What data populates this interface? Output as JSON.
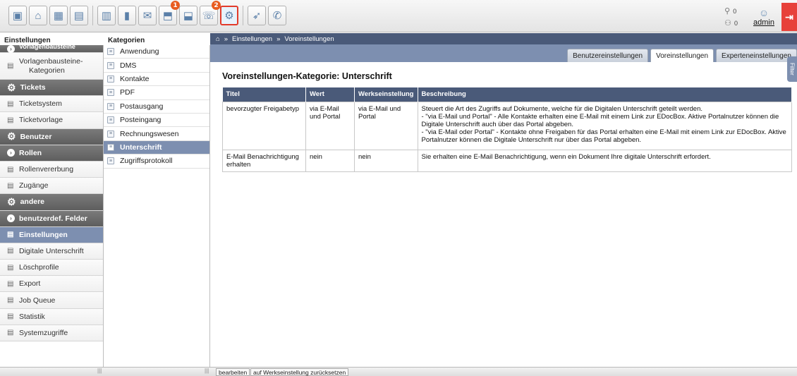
{
  "toolbar": {
    "buttons": [
      {
        "icon": "screen-icon",
        "glyph": "▣"
      },
      {
        "icon": "home-icon",
        "glyph": "⌂"
      },
      {
        "icon": "calendar-icon",
        "glyph": "▦"
      },
      {
        "icon": "document-icon",
        "glyph": "▤"
      },
      {
        "icon": "scanner-icon",
        "glyph": "▥"
      },
      {
        "icon": "chart-icon",
        "glyph": "▮"
      },
      {
        "icon": "mail-icon",
        "glyph": "✉"
      },
      {
        "icon": "inbox-icon",
        "glyph": "⬒",
        "badge": "1"
      },
      {
        "icon": "outbox-icon",
        "glyph": "⬓"
      },
      {
        "icon": "fax-icon",
        "glyph": "☏",
        "badge": "2"
      },
      {
        "icon": "settings-icon",
        "glyph": "⚙",
        "active": true
      },
      {
        "icon": "rocket-icon",
        "glyph": "➶"
      },
      {
        "icon": "phone-icon",
        "glyph": "✆"
      }
    ],
    "count_top": "0",
    "count_bottom": "0",
    "user": "admin",
    "logout_glyph": "⇥"
  },
  "headers": {
    "left": "Einstellungen",
    "mid": "Kategorien"
  },
  "left_panel": {
    "items": [
      {
        "label": "Vorlagenbausteine",
        "type": "dark-cut"
      },
      {
        "label": "Vorlagenbausteine-",
        "label2": "Kategorien",
        "type": "doc-tall"
      },
      {
        "label": "Tickets",
        "type": "dark-gear"
      },
      {
        "label": "Ticketsystem",
        "type": "doc"
      },
      {
        "label": "Ticketvorlage",
        "type": "doc"
      },
      {
        "label": "Benutzer",
        "type": "dark-gear"
      },
      {
        "label": "Rollen",
        "type": "dark-arrow"
      },
      {
        "label": "Rollenvererbung",
        "type": "doc"
      },
      {
        "label": "Zugänge",
        "type": "doc"
      },
      {
        "label": "andere",
        "type": "dark-gear"
      },
      {
        "label": "benutzerdef. Felder",
        "type": "dark-arrow"
      },
      {
        "label": "Einstellungen",
        "type": "selected"
      },
      {
        "label": "Digitale Unterschrift",
        "type": "doc"
      },
      {
        "label": "Löschprofile",
        "type": "doc"
      },
      {
        "label": "Export",
        "type": "doc"
      },
      {
        "label": "Job Queue",
        "type": "doc"
      },
      {
        "label": "Statistik",
        "type": "doc"
      },
      {
        "label": "Systemzugriffe",
        "type": "doc"
      }
    ]
  },
  "mid_panel": {
    "items": [
      {
        "label": "Anwendung"
      },
      {
        "label": "DMS"
      },
      {
        "label": "Kontakte"
      },
      {
        "label": "PDF"
      },
      {
        "label": "Postausgang"
      },
      {
        "label": "Posteingang"
      },
      {
        "label": "Rechnungswesen"
      },
      {
        "label": "Unterschrift",
        "selected": true
      },
      {
        "label": "Zugriffsprotokoll"
      }
    ]
  },
  "breadcrumb": {
    "home_glyph": "⌂",
    "sep": "»",
    "items": [
      "Einstellungen",
      "Voreinstellungen"
    ]
  },
  "tabs": [
    "Benutzereinstellungen",
    "Voreinstellungen",
    "Experteneinstellungen"
  ],
  "active_tab": 1,
  "side_handle": "Filter",
  "main": {
    "title": "Voreinstellungen-Kategorie: Unterschrift",
    "columns": [
      "Titel",
      "Wert",
      "Werkseinstellung",
      "Beschreibung"
    ],
    "rows": [
      {
        "titel": "bevorzugter Freigabetyp",
        "wert": "via E-Mail und Portal",
        "werk": "via E-Mail und Portal",
        "beschreibung": [
          "Steuert die Art des Zugriffs auf Dokumente, welche für die Digitalen Unterschrift geteilt werden.",
          "- \"via E-Mail und Portal\" - Alle Kontakte erhalten eine E-Mail mit einem Link zur EDocBox. Aktive Portalnutzer können die Digitale Unterschrift auch über das Portal abgeben.",
          "- \"via E-Mail oder Portal\" - Kontakte ohne Freigaben für das Portal erhalten eine E-Mail mit einem Link zur EDocBox. Aktive Portalnutzer können die Digitale Unterschrift nur über das Portal abgeben."
        ]
      },
      {
        "titel": "E-Mail Benachrichtigung erhalten",
        "wert": "nein",
        "werk": "nein",
        "beschreibung": [
          "Sie erhalten eine E-Mail Benachrichtigung, wenn ein Dokument Ihre digitale Unterschrift erfordert."
        ]
      }
    ]
  },
  "bottom": {
    "edit_label": "bearbeiten",
    "reset_label": "auf Werkseinstellung zurücksetzen",
    "grip": "|||"
  },
  "colors": {
    "header_dark": "#4a5a79",
    "accent": "#7d8fb0",
    "badge": "#e85c20",
    "logout": "#e7413a"
  }
}
